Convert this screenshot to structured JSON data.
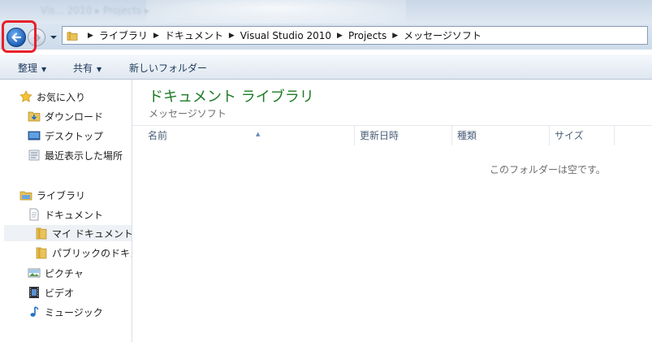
{
  "window": {
    "title_blurred": "Vis... 2010 ▸ Projects ▸"
  },
  "navigation": {
    "back_icon": "back-arrow-icon",
    "forward_icon": "forward-arrow-icon",
    "highlight_color": "#e8202a"
  },
  "address": {
    "breadcrumbs": [
      "ライブラリ",
      "ドキュメント",
      "Visual Studio 2010",
      "Projects",
      "メッセージソフト"
    ]
  },
  "toolbar": {
    "organize": "整理",
    "share": "共有",
    "new_folder": "新しいフォルダー"
  },
  "sidebar": {
    "favorites": "お気に入り",
    "downloads": "ダウンロード",
    "desktop": "デスクトップ",
    "recent": "最近表示した場所",
    "libraries": "ライブラリ",
    "documents": "ドキュメント",
    "my_documents": "マイ ドキュメント",
    "public_documents": "パブリックのドキュメント",
    "pictures": "ピクチャ",
    "videos": "ビデオ",
    "music": "ミュージック"
  },
  "content": {
    "title": "ドキュメント ライブラリ",
    "subtitle": "メッセージソフト",
    "columns": [
      "名前",
      "更新日時",
      "種類",
      "サイズ"
    ],
    "empty_message": "このフォルダーは空です。"
  },
  "colors": {
    "title_green": "#1e7b25",
    "accent_blue": "#1f5fb5"
  }
}
